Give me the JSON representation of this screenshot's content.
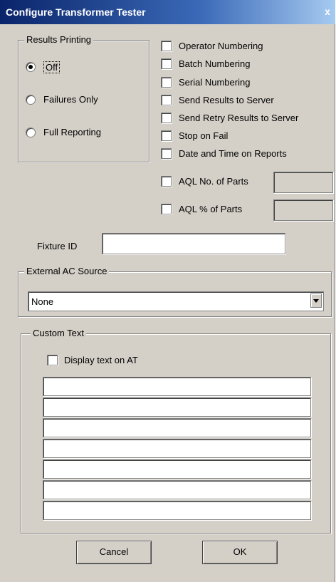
{
  "window": {
    "title": "Configure Transformer Tester",
    "close_glyph": "x"
  },
  "results_printing": {
    "legend": "Results Printing",
    "options": [
      "Off",
      "Failures Only",
      "Full Reporting"
    ],
    "selected": "Off"
  },
  "options": {
    "operator_numbering": "Operator Numbering",
    "batch_numbering": "Batch Numbering",
    "serial_numbering": "Serial Numbering",
    "send_results_to_server": "Send Results to Server",
    "send_retry_results_to_server": "Send Retry Results to Server",
    "stop_on_fail": "Stop on Fail",
    "date_and_time_on_reports": "Date and Time on Reports",
    "aql_no_of_parts": "AQL No. of Parts",
    "aql_pct_of_parts": "AQL % of Parts"
  },
  "fixture": {
    "label": "Fixture ID",
    "value": ""
  },
  "external_ac_source": {
    "legend": "External AC Source",
    "selected": "None"
  },
  "custom_text": {
    "legend": "Custom Text",
    "display_text_label": "Display text on AT",
    "lines": [
      "",
      "",
      "",
      "",
      "",
      "",
      ""
    ]
  },
  "buttons": {
    "cancel": "Cancel",
    "ok": "OK"
  }
}
